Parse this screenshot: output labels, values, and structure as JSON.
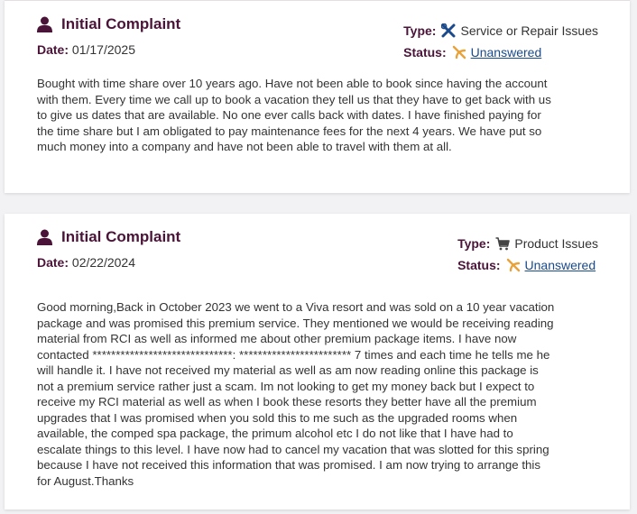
{
  "complaints": [
    {
      "title": "Initial Complaint",
      "date_label": "Date:",
      "date": "01/17/2025",
      "type_label": "Type:",
      "type_value": "Service or Repair Issues",
      "type_icon": "wrench-screwdriver-icon",
      "status_label": "Status:",
      "status_value": "Unanswered",
      "status_icon": "unanswered-icon",
      "body": "Bought with time share over 10 years ago. Have not been able to book since having the account with them. Every time we call up to book a vacation they tell us that they have to get back with us to give us dates that are available. No one ever calls back with dates. I have finished paying for the time share but I am obligated to pay maintenance fees for the next 4 years. We have put so much money into a company and have not been able to travel with them at all."
    },
    {
      "title": "Initial Complaint",
      "date_label": "Date:",
      "date": "02/22/2024",
      "type_label": "Type:",
      "type_value": "Product Issues",
      "type_icon": "shopping-cart-icon",
      "status_label": "Status:",
      "status_value": "Unanswered",
      "status_icon": "unanswered-icon",
      "body": "Good morning,Back in October 2023 we went to a Viva resort and was sold on a 10 year vacation package and was promised this premium service. They mentioned we would be receiving reading material from RCI as well as informed me about other premium package items. I have now contacted ******************************: ************************ 7 times and each time he tells me he will handle it. I have not received my material as well as am now reading online this package is not a premium service rather just a scam. Im not looking to get my money back but I expect to receive my RCI material as well as when I book these resorts they better have all the premium upgrades that I was promised when you sold this to me such as the upgraded rooms when available, the comped spa package, the primum alcohol etc I do not like that I have had to escalate things to this level. I have now had to cancel my vacation that was slotted for this spring because I have not received this information that was promised. I am now trying to arrange this for August.Thanks"
    }
  ],
  "colors": {
    "title": "#4a1438",
    "type_icon": "#1a4a8a",
    "status_icon": "#e8a23a",
    "link": "#1a4a8a"
  }
}
